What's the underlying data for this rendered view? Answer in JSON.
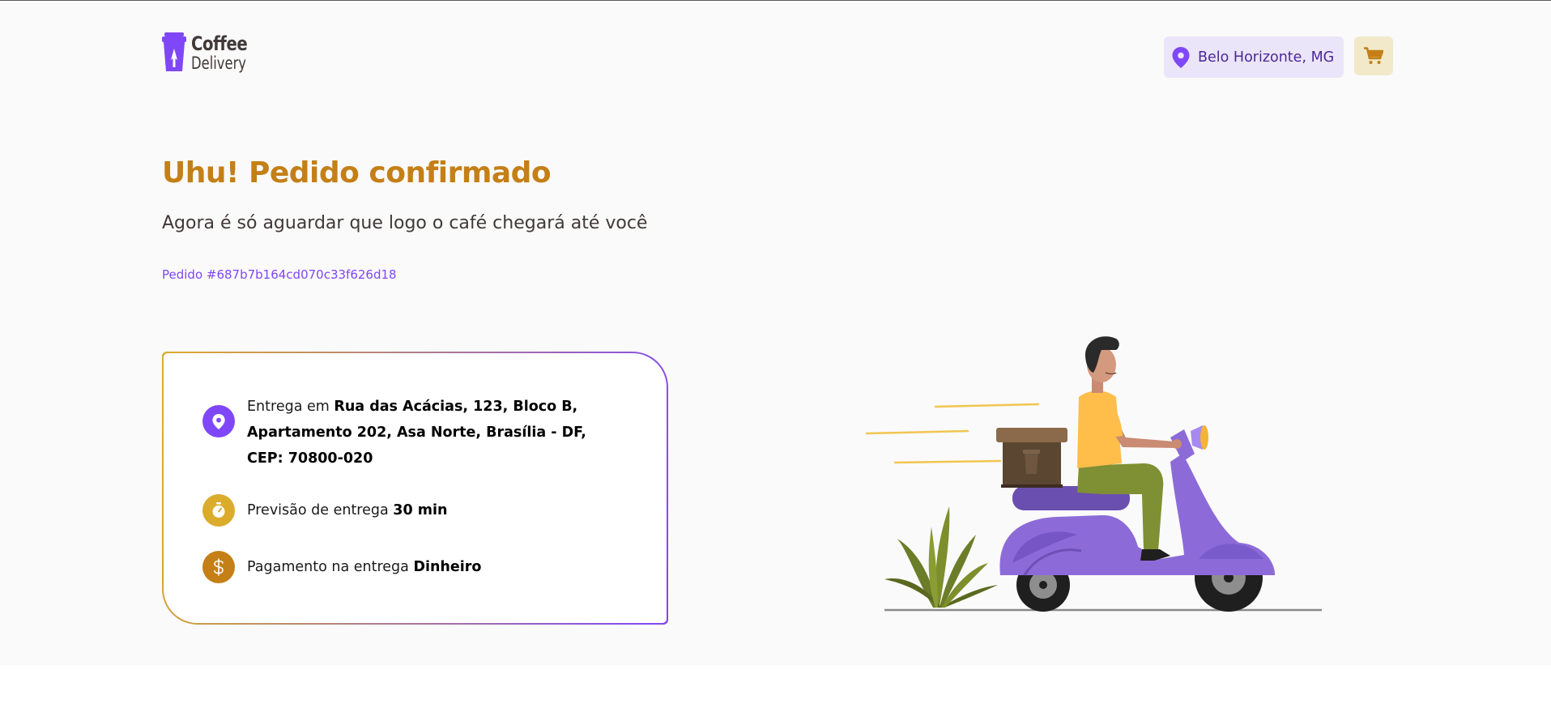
{
  "header": {
    "logo": {
      "line1": "Coffee",
      "line2": "Delivery"
    },
    "location": {
      "icon": "map-pin-icon",
      "label": "Belo Horizonte, MG"
    },
    "cart": {
      "icon": "shopping-cart-icon"
    }
  },
  "confirmation": {
    "title": "Uhu! Pedido confirmado",
    "subtitle": "Agora é só aguardar que logo o café chegará até você",
    "order_id": "Pedido #687b7b164cd070c33f626d18"
  },
  "info": {
    "address": {
      "icon": "map-pin-icon",
      "prefix": "Entrega em ",
      "value": "Rua das Acácias, 123, Bloco B, Apartamento 202, Asa Norte, Brasília - DF, CEP: 70800-020"
    },
    "time": {
      "icon": "timer-icon",
      "prefix": "Previsão de entrega ",
      "value": "30 min"
    },
    "payment": {
      "icon": "currency-dollar-icon",
      "prefix": "Pagamento na entrega ",
      "value": "Dinheiro"
    }
  },
  "colors": {
    "yellow_dark": "#c47f17",
    "yellow": "#dbac2c",
    "purple": "#8047f8",
    "purple_dark": "#4b2995",
    "purple_light": "#ebe5f9",
    "yellow_light": "#f1e9c9"
  }
}
